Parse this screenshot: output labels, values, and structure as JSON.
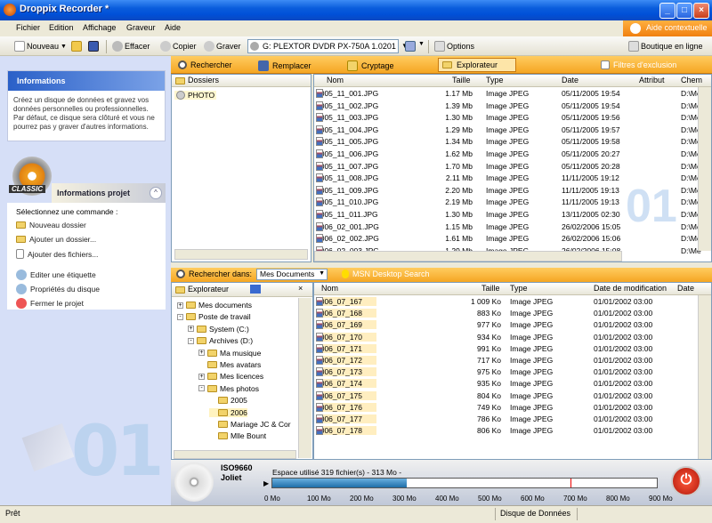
{
  "window": {
    "title": "Droppix Recorder *"
  },
  "menu": [
    "Fichier",
    "Edition",
    "Affichage",
    "Graveur",
    "Aide"
  ],
  "context_help": "Aide contextuelle",
  "toolbar": {
    "nouveau": "Nouveau",
    "effacer": "Effacer",
    "copier": "Copier",
    "graver": "Graver",
    "drive": "G: PLEXTOR DVDR   PX-750A  1.0201",
    "options": "Options",
    "boutique": "Boutique en ligne"
  },
  "left": {
    "info_title": "Informations",
    "info_text": "Créez un disque de données et gravez vos données personnelles ou professionnelles. Par défaut, ce disque sera clôturé et vous ne pourrez pas y graver d'autres informations.",
    "logo_text": "CLASSIC",
    "project_title": "Informations projet",
    "select_cmd": "Sélectionnez une commande :",
    "commands": [
      "Nouveau dossier",
      "Ajouter un dossier...",
      "Ajouter des fichiers...",
      "Editer une étiquette",
      "Propriétés du disque",
      "Fermer le projet"
    ],
    "big_number": "01"
  },
  "search_bar": {
    "rechercher": "Rechercher",
    "remplacer": "Remplacer",
    "cryptage": "Cryptage",
    "explorateur": "Explorateur",
    "filtres": "Filtres d'exclusion"
  },
  "folders": {
    "header": "Dossiers",
    "items": [
      "PHOTO"
    ]
  },
  "list1": {
    "columns": [
      "Nom",
      "Taille",
      "Type",
      "Date",
      "Attribut",
      "Chem"
    ],
    "rows": [
      {
        "name": "2005_11_001.JPG",
        "size": "1.17 Mb",
        "type": "Image JPEG",
        "date": "05/11/2005 19:54",
        "path": "D:\\Me"
      },
      {
        "name": "2005_11_002.JPG",
        "size": "1.39 Mb",
        "type": "Image JPEG",
        "date": "05/11/2005 19:54",
        "path": "D:\\Me"
      },
      {
        "name": "2005_11_003.JPG",
        "size": "1.30 Mb",
        "type": "Image JPEG",
        "date": "05/11/2005 19:56",
        "path": "D:\\Me"
      },
      {
        "name": "2005_11_004.JPG",
        "size": "1.29 Mb",
        "type": "Image JPEG",
        "date": "05/11/2005 19:57",
        "path": "D:\\Me"
      },
      {
        "name": "2005_11_005.JPG",
        "size": "1.34 Mb",
        "type": "Image JPEG",
        "date": "05/11/2005 19:58",
        "path": "D:\\Me"
      },
      {
        "name": "2005_11_006.JPG",
        "size": "1.62 Mb",
        "type": "Image JPEG",
        "date": "05/11/2005 20:27",
        "path": "D:\\Me"
      },
      {
        "name": "2005_11_007.JPG",
        "size": "1.70 Mb",
        "type": "Image JPEG",
        "date": "05/11/2005 20:28",
        "path": "D:\\Me"
      },
      {
        "name": "2005_11_008.JPG",
        "size": "2.11 Mb",
        "type": "Image JPEG",
        "date": "11/11/2005 19:12",
        "path": "D:\\Me"
      },
      {
        "name": "2005_11_009.JPG",
        "size": "2.20 Mb",
        "type": "Image JPEG",
        "date": "11/11/2005 19:13",
        "path": "D:\\Me"
      },
      {
        "name": "2005_11_010.JPG",
        "size": "2.19 Mb",
        "type": "Image JPEG",
        "date": "11/11/2005 19:13",
        "path": "D:\\Me"
      },
      {
        "name": "2005_11_011.JPG",
        "size": "1.30 Mb",
        "type": "Image JPEG",
        "date": "13/11/2005 02:30",
        "path": "D:\\Me"
      },
      {
        "name": "2006_02_001.JPG",
        "size": "1.15 Mb",
        "type": "Image JPEG",
        "date": "26/02/2006 15:05",
        "path": "D:\\Me"
      },
      {
        "name": "2006_02_002.JPG",
        "size": "1.61 Mb",
        "type": "Image JPEG",
        "date": "26/02/2006 15:06",
        "path": "D:\\Me"
      },
      {
        "name": "2006_02_003.JPG",
        "size": "1.29 Mb",
        "type": "Image JPEG",
        "date": "26/02/2006 15:08",
        "path": "D:\\Me"
      }
    ]
  },
  "mid_search": {
    "label": "Rechercher dans:",
    "value": "Mes Documents",
    "msn": "MSN Desktop Search"
  },
  "explorer": {
    "tab": "Explorateur",
    "tree": [
      "Mes documents",
      "Poste de travail",
      "System (C:)",
      "Archives (D:)",
      "Ma musique",
      "Mes avatars",
      "Mes licences",
      "Mes photos",
      "2005",
      "2006",
      "Mariage JC & Cor",
      "Mlle Bount"
    ]
  },
  "list2": {
    "columns": [
      "Nom",
      "Taille",
      "Type",
      "Date de modification",
      "Date"
    ],
    "rows": [
      {
        "name": "2006_07_167",
        "size": "1 009 Ko",
        "type": "Image JPEG",
        "date": "01/01/2002 03:00"
      },
      {
        "name": "2006_07_168",
        "size": "883 Ko",
        "type": "Image JPEG",
        "date": "01/01/2002 03:00"
      },
      {
        "name": "2006_07_169",
        "size": "977 Ko",
        "type": "Image JPEG",
        "date": "01/01/2002 03:00"
      },
      {
        "name": "2006_07_170",
        "size": "934 Ko",
        "type": "Image JPEG",
        "date": "01/01/2002 03:00"
      },
      {
        "name": "2006_07_171",
        "size": "991 Ko",
        "type": "Image JPEG",
        "date": "01/01/2002 03:00"
      },
      {
        "name": "2006_07_172",
        "size": "717 Ko",
        "type": "Image JPEG",
        "date": "01/01/2002 03:00"
      },
      {
        "name": "2006_07_173",
        "size": "975 Ko",
        "type": "Image JPEG",
        "date": "01/01/2002 03:00"
      },
      {
        "name": "2006_07_174",
        "size": "935 Ko",
        "type": "Image JPEG",
        "date": "01/01/2002 03:00"
      },
      {
        "name": "2006_07_175",
        "size": "804 Ko",
        "type": "Image JPEG",
        "date": "01/01/2002 03:00"
      },
      {
        "name": "2006_07_176",
        "size": "749 Ko",
        "type": "Image JPEG",
        "date": "01/01/2002 03:00"
      },
      {
        "name": "2006_07_177",
        "size": "786 Ko",
        "type": "Image JPEG",
        "date": "01/01/2002 03:00"
      },
      {
        "name": "2006_07_178",
        "size": "806 Ko",
        "type": "Image JPEG",
        "date": "01/01/2002 03:00"
      }
    ]
  },
  "burn": {
    "fs1": "ISO9660",
    "fs2": "Joliet",
    "used_text": "Espace utilisé 319 fichier(s) - 313 Mo -",
    "fill_fraction": 0.35,
    "scale": [
      "0 Mo",
      "100 Mo",
      "200 Mo",
      "300 Mo",
      "400 Mo",
      "500 Mo",
      "600 Mo",
      "700 Mo",
      "800 Mo",
      "900 Mo"
    ]
  },
  "status": {
    "left": "Prêt",
    "right": "Disque de Données"
  },
  "colors": {
    "orange": "#f5a623",
    "xpblue": "#0a5ddc",
    "bar": "#2e7fb8"
  }
}
